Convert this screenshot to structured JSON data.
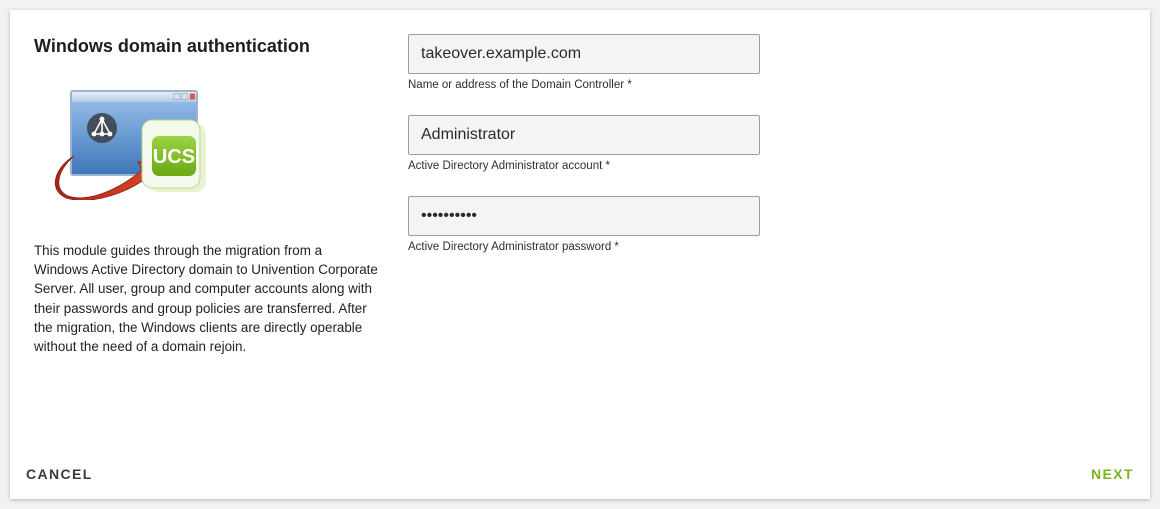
{
  "dialog": {
    "title": "Windows domain authentication",
    "illustration_icon": "ad-to-ucs-migration-icon",
    "illustration_text": "UCS",
    "description": "This module guides through the migration from a Windows Active Directory domain to Univention Corporate Server. All user, group and computer accounts along with their passwords and group policies are transferred. After the migration, the Windows clients are directly operable without the need of a domain rejoin."
  },
  "fields": {
    "domain_controller": {
      "value": "takeover.example.com",
      "label": "Name or address of the Domain Controller *"
    },
    "admin_account": {
      "value": "Administrator",
      "label": "Active Directory Administrator account *"
    },
    "admin_password": {
      "value": "1234567890",
      "label": "Active Directory Administrator password *"
    }
  },
  "buttons": {
    "cancel": "CANCEL",
    "next": "NEXT"
  },
  "colors": {
    "accent": "#7ab51d",
    "arrow": "#c8301c",
    "window_blue": "#4f86c6"
  }
}
